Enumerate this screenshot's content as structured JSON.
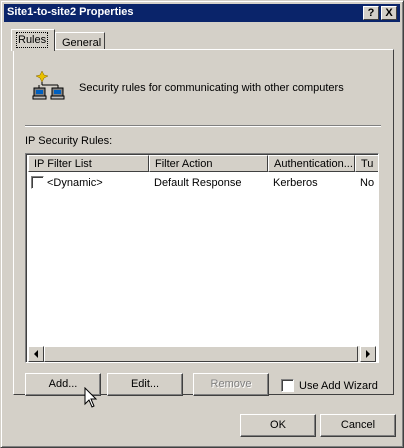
{
  "window": {
    "title": "Site1-to-site2 Properties",
    "help_label": "?",
    "close_label": "X"
  },
  "tabs": [
    {
      "label": "Rules",
      "active": true
    },
    {
      "label": "General",
      "active": false
    }
  ],
  "rules_tab": {
    "description": "Security rules for communicating with other computers",
    "list_label": "IP Security Rules:",
    "columns": [
      "IP Filter List",
      "Filter Action",
      "Authentication...",
      "Tu"
    ],
    "rows": [
      {
        "checked": false,
        "cells": [
          "<Dynamic>",
          "Default Response",
          "Kerberos",
          "No"
        ]
      }
    ],
    "buttons": {
      "add": "Add...",
      "edit": "Edit...",
      "remove": "Remove"
    },
    "use_wizard_label": "Use Add Wizard",
    "use_wizard_checked": false
  },
  "footer": {
    "ok": "OK",
    "cancel": "Cancel"
  },
  "icons": [
    "network-computers-icon",
    "cursor-icon"
  ]
}
